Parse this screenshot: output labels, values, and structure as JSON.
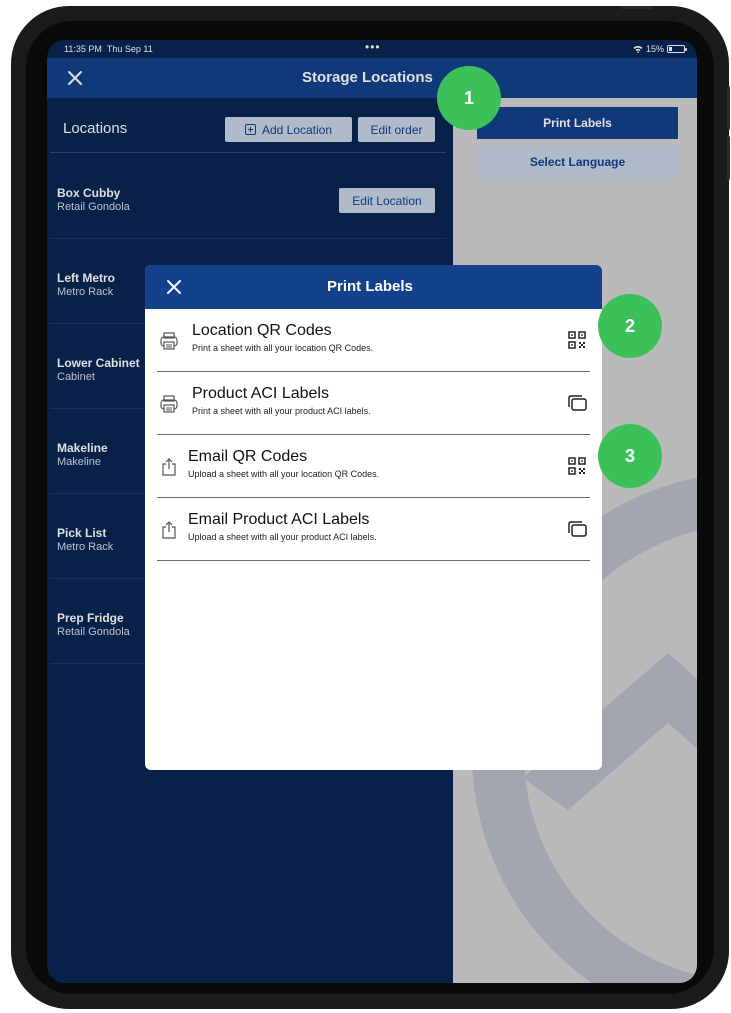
{
  "status_bar": {
    "time": "11:35 PM",
    "date": "Thu Sep 11",
    "dots": "•••",
    "battery": "15%"
  },
  "nav": {
    "title": "Storage Locations"
  },
  "locations": {
    "header": "Locations",
    "add_label": "Add Location",
    "edit_order_label": "Edit order",
    "edit_location_label": "Edit Location",
    "items": [
      {
        "name": "Box Cubby",
        "type": "Retail Gondola"
      },
      {
        "name": "Left Metro",
        "type": "Metro Rack"
      },
      {
        "name": "Lower Cabinet",
        "type": "Cabinet"
      },
      {
        "name": "Makeline",
        "type": "Makeline"
      },
      {
        "name": "Pick List",
        "type": "Metro Rack"
      },
      {
        "name": "Prep Fridge",
        "type": "Retail Gondola"
      }
    ]
  },
  "right_panel": {
    "print_labels": "Print Labels",
    "select_language": "Select Language"
  },
  "modal": {
    "title": "Print Labels",
    "options": [
      {
        "title": "Location QR Codes",
        "desc": "Print a sheet with all your location QR Codes.",
        "left_icon": "printer-icon",
        "right_icon": "qr-code-icon"
      },
      {
        "title": "Product ACI Labels",
        "desc": "Print a sheet with all your product ACI labels.",
        "left_icon": "printer-icon",
        "right_icon": "label-stack-icon"
      },
      {
        "title": "Email QR Codes",
        "desc": "Upload a sheet with all your location QR Codes.",
        "left_icon": "share-icon",
        "right_icon": "qr-code-icon"
      },
      {
        "title": "Email Product ACI Labels",
        "desc": "Upload a sheet with all your product ACI labels.",
        "left_icon": "share-icon",
        "right_icon": "label-stack-icon"
      }
    ]
  },
  "callouts": [
    "1",
    "2",
    "3"
  ],
  "colors": {
    "navy": "#082654",
    "header_blue": "#13418b",
    "button_light": "#c9d4e6",
    "callout_green": "#3cc05a",
    "panel_gray": "#d4d4d4"
  }
}
